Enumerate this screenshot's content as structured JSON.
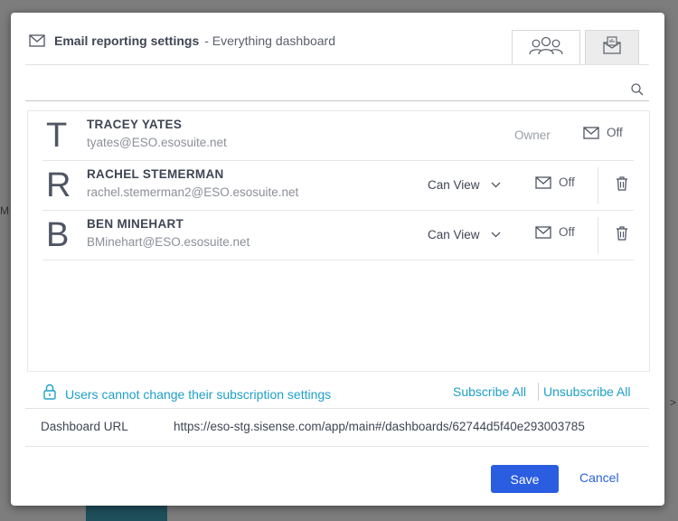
{
  "header": {
    "title": "Email reporting settings",
    "subtitle": "- Everything dashboard",
    "icon": "envelope-icon"
  },
  "tabs": [
    {
      "name": "users",
      "icon": "users-group-icon",
      "active": true
    },
    {
      "name": "report",
      "icon": "report-inbox-icon",
      "active": false
    }
  ],
  "search": {
    "placeholder": "",
    "value": "",
    "icon": "search-icon"
  },
  "users": [
    {
      "initial": "T",
      "name": "TRACEY YATES",
      "email": "tyates@ESO.esosuite.net",
      "role": "Owner",
      "email_status": "Off",
      "role_editable": false
    },
    {
      "initial": "R",
      "name": "RACHEL STEMERMAN",
      "email": "rachel.stemerman2@ESO.esosuite.net",
      "role": "Can View",
      "email_status": "Off",
      "role_editable": true
    },
    {
      "initial": "B",
      "name": "BEN MINEHART",
      "email": "BMinehart@ESO.esosuite.net",
      "role": "Can View",
      "email_status": "Off",
      "role_editable": true
    }
  ],
  "footer": {
    "lock_text": "Users cannot change their subscription settings",
    "subscribe_all": "Subscribe All",
    "unsubscribe_all": "Unsubscribe All",
    "url_label": "Dashboard URL",
    "url_value": "https://eso-stg.sisense.com/app/main#/dashboards/62744d5f40e293003785"
  },
  "buttons": {
    "save": "Save",
    "cancel": "Cancel"
  },
  "colors": {
    "primary": "#2a5de0",
    "link": "#1ea0c9"
  }
}
